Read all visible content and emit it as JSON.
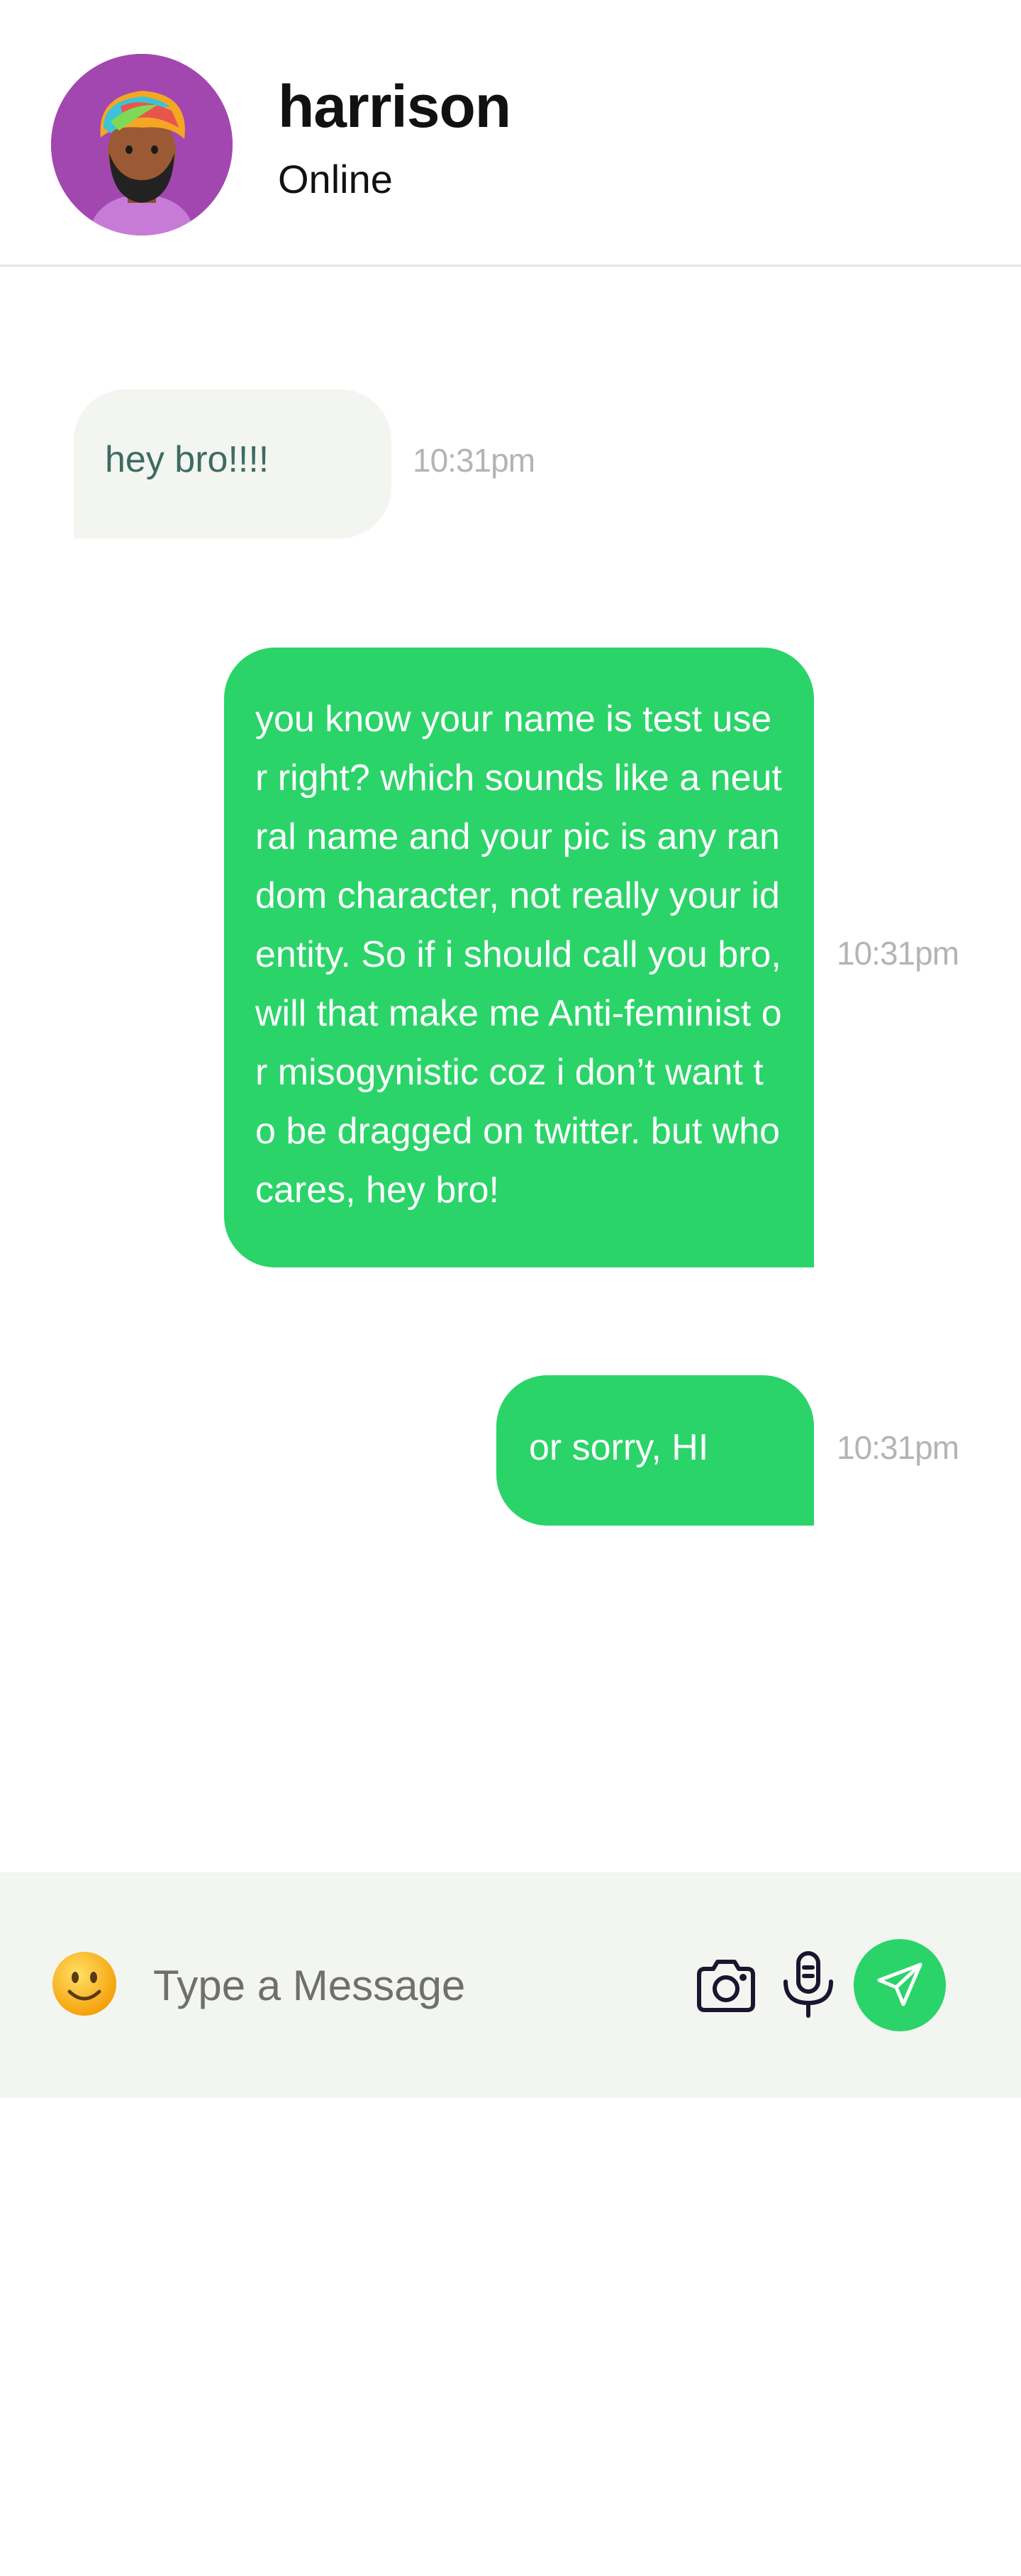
{
  "header": {
    "contact_name": "harrison",
    "status": "Online",
    "avatar_icon": "avatar-turban-character"
  },
  "messages": [
    {
      "direction": "incoming",
      "text": "hey bro!!!!",
      "time": "10:31pm"
    },
    {
      "direction": "outgoing",
      "text": "you know your name is test user right? which sounds like a neutral name and your pic is any random character, not really your identity. So if i should call you bro, will that make me Anti-feminist or misogynistic coz i don’t want to be dragged on twitter. but who cares, hey bro!",
      "time": "10:31pm"
    },
    {
      "direction": "outgoing",
      "text": "or sorry, HI",
      "time": "10:31pm"
    }
  ],
  "composer": {
    "placeholder": "Type a Message",
    "value": "",
    "emoji_icon": "smiley-emoji-icon",
    "camera_icon": "camera-icon",
    "mic_icon": "microphone-icon",
    "send_icon": "send-icon"
  },
  "colors": {
    "accent": "#2ad469",
    "incoming_bubble": "#f3f5f0",
    "incoming_text": "#3d6b63",
    "timestamp": "#b4b4b4",
    "avatar_bg": "#a347b0"
  }
}
